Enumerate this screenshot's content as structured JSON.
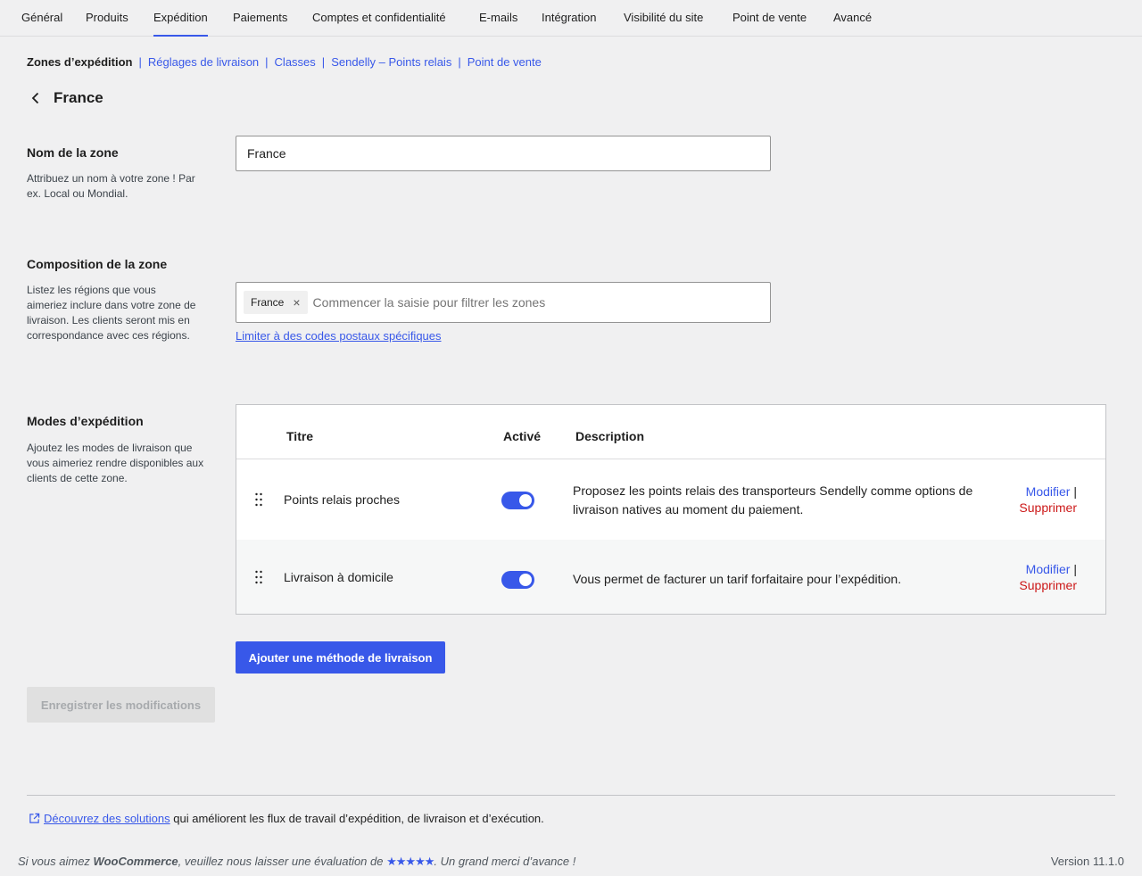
{
  "tabs": [
    {
      "label": "Général"
    },
    {
      "label": "Produits"
    },
    {
      "label": "Expédition",
      "active": true
    },
    {
      "label": "Paiements"
    },
    {
      "label": "Comptes et confidentialité"
    },
    {
      "label": "E-mails"
    },
    {
      "label": "Intégration"
    },
    {
      "label": "Visibilité du site"
    },
    {
      "label": "Point de vente"
    },
    {
      "label": "Avancé"
    }
  ],
  "subnav": {
    "current": "Zones d’expédition",
    "links": [
      "Réglages de livraison",
      "Classes",
      "Sendelly – Points relais",
      "Point de vente"
    ],
    "separator": "|"
  },
  "page": {
    "title": "France"
  },
  "zone_name": {
    "label": "Nom de la zone",
    "help": "Attribuez un nom à votre zone ! Par ex. Local ou Mondial.",
    "value": "France"
  },
  "zone_regions": {
    "label": "Composition de la zone",
    "help": "Listez les régions que vous aimeriez inclure dans votre zone de livraison. Les clients seront mis en correspondance avec ces régions.",
    "tokens": [
      "France"
    ],
    "placeholder": "Commencer la saisie pour filtrer les zones",
    "postcode_link": "Limiter à des codes postaux spécifiques"
  },
  "methods": {
    "label": "Modes d’expédition",
    "help": "Ajoutez les modes de livraison que vous aimeriez rendre disponibles aux clients de cette zone.",
    "headers": {
      "title": "Titre",
      "enabled": "Activé",
      "description": "Description"
    },
    "rows": [
      {
        "title": "Points relais proches",
        "enabled": true,
        "description": "Proposez les points relais des transporteurs Sendelly comme options de livraison natives au moment du paiement.",
        "edit": "Modifier",
        "delete": "Supprimer"
      },
      {
        "title": "Livraison à domicile",
        "enabled": true,
        "description": "Vous permet de facturer un tarif forfaitaire pour l’expédition.",
        "edit": "Modifier",
        "delete": "Supprimer"
      }
    ],
    "add_button": "Ajouter une méthode de livraison"
  },
  "save_button": "Enregistrer les modifications",
  "discover": {
    "link": "Découvrez des solutions",
    "text": " qui améliorent les flux de travail d’expédition, de livraison et d’exécution."
  },
  "footer": {
    "prefix": "Si vous aimez ",
    "brand": "WooCommerce",
    "middle": ", veuillez nous laisser une évaluation de ",
    "stars": "★★★★★",
    "suffix": ". Un grand merci d’avance !",
    "version": "Version 11.1.0"
  },
  "colors": {
    "accent": "#3858e9",
    "danger": "#cc1818",
    "background": "#f0f0f1"
  }
}
